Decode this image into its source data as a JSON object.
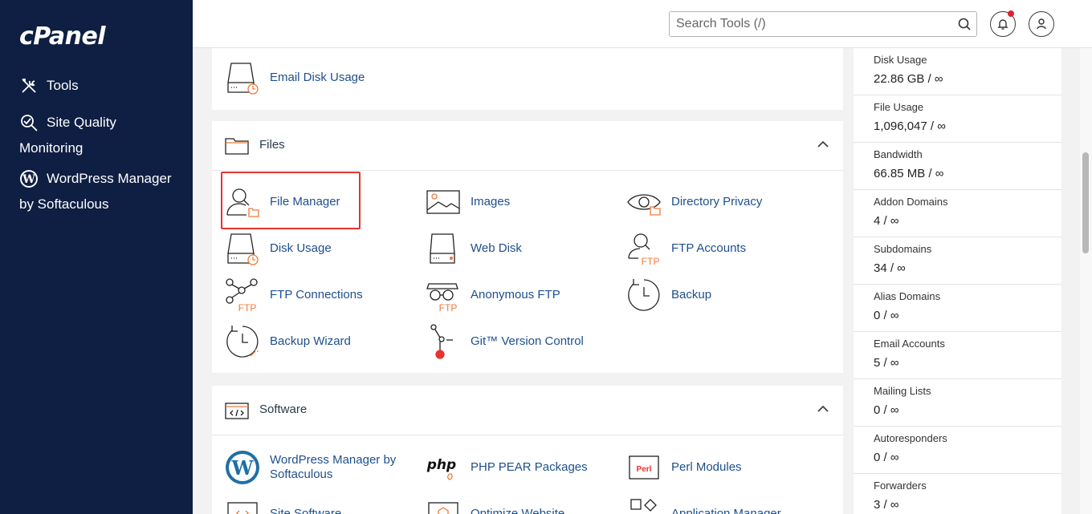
{
  "sidebar": {
    "logo": "cPanel",
    "items": [
      {
        "label": "Tools",
        "icon": "tools-icon"
      },
      {
        "label": "Site Quality Monitoring",
        "icon": "site-quality-icon"
      },
      {
        "label": "WordPress Manager by Softaculous",
        "icon": "wordpress-icon"
      }
    ]
  },
  "header": {
    "search_placeholder": "Search Tools (/)"
  },
  "main": {
    "prev_section": {
      "tools": [
        {
          "label": "Email Disk Usage",
          "icon": "disk-usage-icon"
        }
      ]
    },
    "files": {
      "title": "Files",
      "tools": [
        {
          "label": "File Manager",
          "icon": "file-manager-icon"
        },
        {
          "label": "Images",
          "icon": "images-icon"
        },
        {
          "label": "Directory Privacy",
          "icon": "directory-privacy-icon"
        },
        {
          "label": "Disk Usage",
          "icon": "disk-usage-icon"
        },
        {
          "label": "Web Disk",
          "icon": "web-disk-icon"
        },
        {
          "label": "FTP Accounts",
          "icon": "ftp-accounts-icon"
        },
        {
          "label": "FTP Connections",
          "icon": "ftp-connections-icon"
        },
        {
          "label": "Anonymous FTP",
          "icon": "anonymous-ftp-icon"
        },
        {
          "label": "Backup",
          "icon": "backup-icon"
        },
        {
          "label": "Backup Wizard",
          "icon": "backup-wizard-icon"
        },
        {
          "label": "Git™ Version Control",
          "icon": "git-icon"
        }
      ]
    },
    "software": {
      "title": "Software",
      "tools": [
        {
          "label": "WordPress Manager by Softaculous",
          "icon": "wordpress-icon"
        },
        {
          "label": "PHP PEAR Packages",
          "icon": "php-icon"
        },
        {
          "label": "Perl Modules",
          "icon": "perl-icon"
        },
        {
          "label": "Site Software",
          "icon": "site-software-icon"
        },
        {
          "label": "Optimize Website",
          "icon": "optimize-website-icon"
        },
        {
          "label": "Application Manager",
          "icon": "application-manager-icon"
        }
      ]
    }
  },
  "stats": [
    {
      "label": "Disk Usage",
      "value": "22.86 GB / ∞"
    },
    {
      "label": "File Usage",
      "value": "1,096,047 / ∞"
    },
    {
      "label": "Bandwidth",
      "value": "66.85 MB / ∞"
    },
    {
      "label": "Addon Domains",
      "value": "4 / ∞"
    },
    {
      "label": "Subdomains",
      "value": "34 / ∞"
    },
    {
      "label": "Alias Domains",
      "value": "0 / ∞"
    },
    {
      "label": "Email Accounts",
      "value": "5 / ∞"
    },
    {
      "label": "Mailing Lists",
      "value": "0 / ∞"
    },
    {
      "label": "Autoresponders",
      "value": "0 / ∞"
    },
    {
      "label": "Forwarders",
      "value": "3 / ∞"
    }
  ],
  "colors": {
    "sidebar_bg": "#0f1f43",
    "link": "#1e4f8c",
    "accent_orange": "#f07a3a",
    "highlight_red": "#e8322e"
  }
}
